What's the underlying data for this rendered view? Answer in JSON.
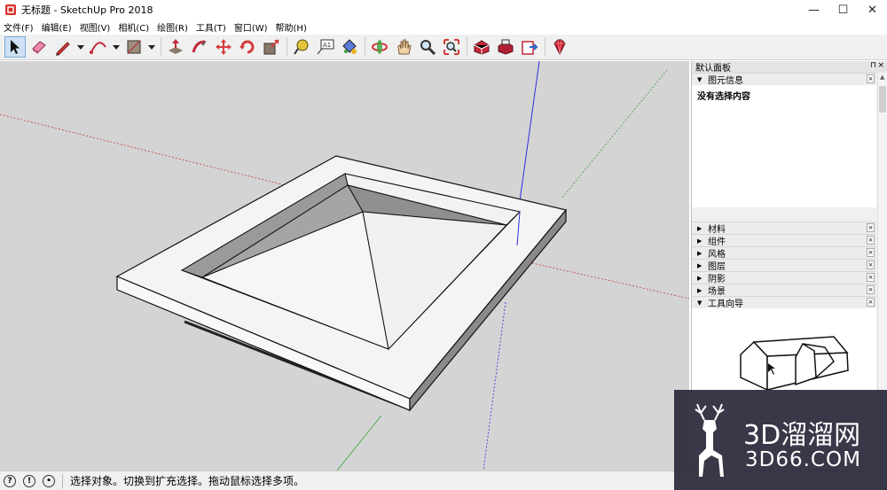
{
  "window": {
    "title": "无标题 - SketchUp Pro 2018",
    "minimize": "—",
    "maximize": "☐",
    "close": "✕"
  },
  "menu": [
    "文件(F)",
    "编辑(E)",
    "视图(V)",
    "相机(C)",
    "绘图(R)",
    "工具(T)",
    "窗口(W)",
    "帮助(H)"
  ],
  "toolbar_icons": [
    "select-icon",
    "eraser-icon",
    "pencil-line-icon",
    "arc-icon",
    "rectangle-icon",
    "push-pull-icon",
    "follow-me-icon",
    "move-icon",
    "rotate-icon",
    "scale-icon",
    "tape-measure-icon",
    "text-icon",
    "paint-bucket-icon",
    "orbit-icon",
    "pan-icon",
    "zoom-icon",
    "zoom-extents-icon",
    "3d-warehouse-icon",
    "extension-warehouse-icon",
    "send-to-layout-icon",
    "ruby-icon"
  ],
  "panel": {
    "title": "默认面板",
    "pin": "⊓",
    "close": "×",
    "entity_info": {
      "label": "图元信息",
      "message": "没有选择内容"
    },
    "trays": [
      "材料",
      "组件",
      "风格",
      "图层",
      "阴影",
      "场景",
      "工具向导"
    ]
  },
  "status": {
    "text": "选择对象。切换到扩充选择。拖动鼠标选择多项。"
  },
  "watermark": {
    "main": "3D溜溜网",
    "sub": "3D66.COM"
  },
  "colors": {
    "red_axis": "#c83c3c",
    "green_axis": "#3aa03a",
    "blue_axis": "#2e2ee0",
    "model_bg": "#d4d4d4"
  }
}
